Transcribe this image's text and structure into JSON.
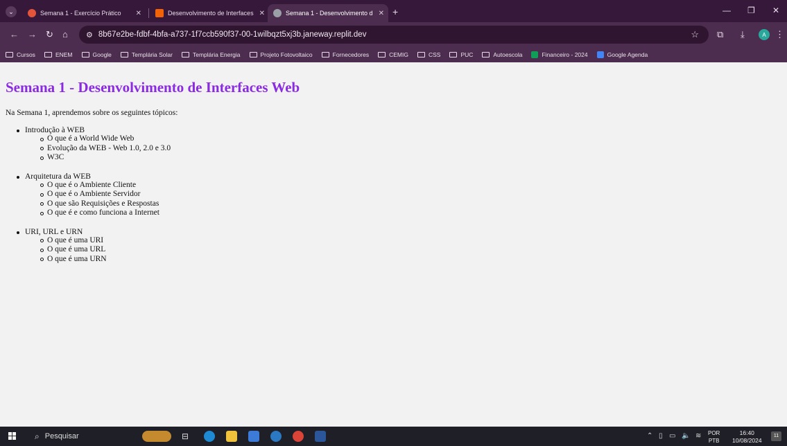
{
  "browser": {
    "tabs": [
      {
        "title": "Semana 1 - Exercício Prático",
        "favicon_color": "#e2553b"
      },
      {
        "title": "Desenvolvimento de Interfaces",
        "favicon_color": "#f26207"
      },
      {
        "title": "Semana 1 - Desenvolvimento d",
        "favicon_color": "#9aa0a6"
      }
    ],
    "address": "8b67e2be-fdbf-4bfa-a737-1f7ccb590f37-00-1wilbqzt5xj3b.janeway.replit.dev",
    "profile_initial": "A",
    "bookmarks": [
      {
        "label": "Cursos",
        "icon": "folder-icon"
      },
      {
        "label": "ENEM",
        "icon": "folder-icon"
      },
      {
        "label": "Google",
        "icon": "folder-icon"
      },
      {
        "label": "Templária Solar",
        "icon": "folder-icon"
      },
      {
        "label": "Templária Energia",
        "icon": "folder-icon"
      },
      {
        "label": "Projeto Fotovoltaico",
        "icon": "folder-icon"
      },
      {
        "label": "Fornecedores",
        "icon": "folder-icon"
      },
      {
        "label": "CEMIG",
        "icon": "folder-icon"
      },
      {
        "label": "CSS",
        "icon": "folder-icon"
      },
      {
        "label": "PUC",
        "icon": "folder-icon"
      },
      {
        "label": "Autoescola",
        "icon": "folder-icon"
      },
      {
        "label": "Financeiro - 2024",
        "icon": "sheets-icon"
      },
      {
        "label": "Google Agenda",
        "icon": "calendar-icon"
      }
    ]
  },
  "page": {
    "title": "Semana 1 - Desenvolvimento de Interfaces Web",
    "title_color": "#8a2be2",
    "intro": "Na Semana 1, aprendemos sobre os seguintes tópicos:",
    "topics": [
      {
        "label": "Introdução à WEB",
        "items": [
          "O que é a World Wide Web",
          "Evolução da WEB - Web 1.0, 2.0 e 3.0",
          "W3C"
        ]
      },
      {
        "label": "Arquitetura da WEB",
        "items": [
          "O que é o Ambiente Cliente",
          "O que é o Ambiente Servidor",
          "O que são Requisições e Respostas",
          "O que é e como funciona a Internet"
        ]
      },
      {
        "label": "URI, URL e URN",
        "items": [
          "O que é uma URI",
          "O que é uma URL",
          "O que é uma URN"
        ]
      }
    ]
  },
  "taskbar": {
    "search_placeholder": "Pesquisar",
    "language": "POR",
    "keyboard": "PTB",
    "time": "16:40",
    "date": "10/08/2024",
    "notification_count": "11"
  }
}
